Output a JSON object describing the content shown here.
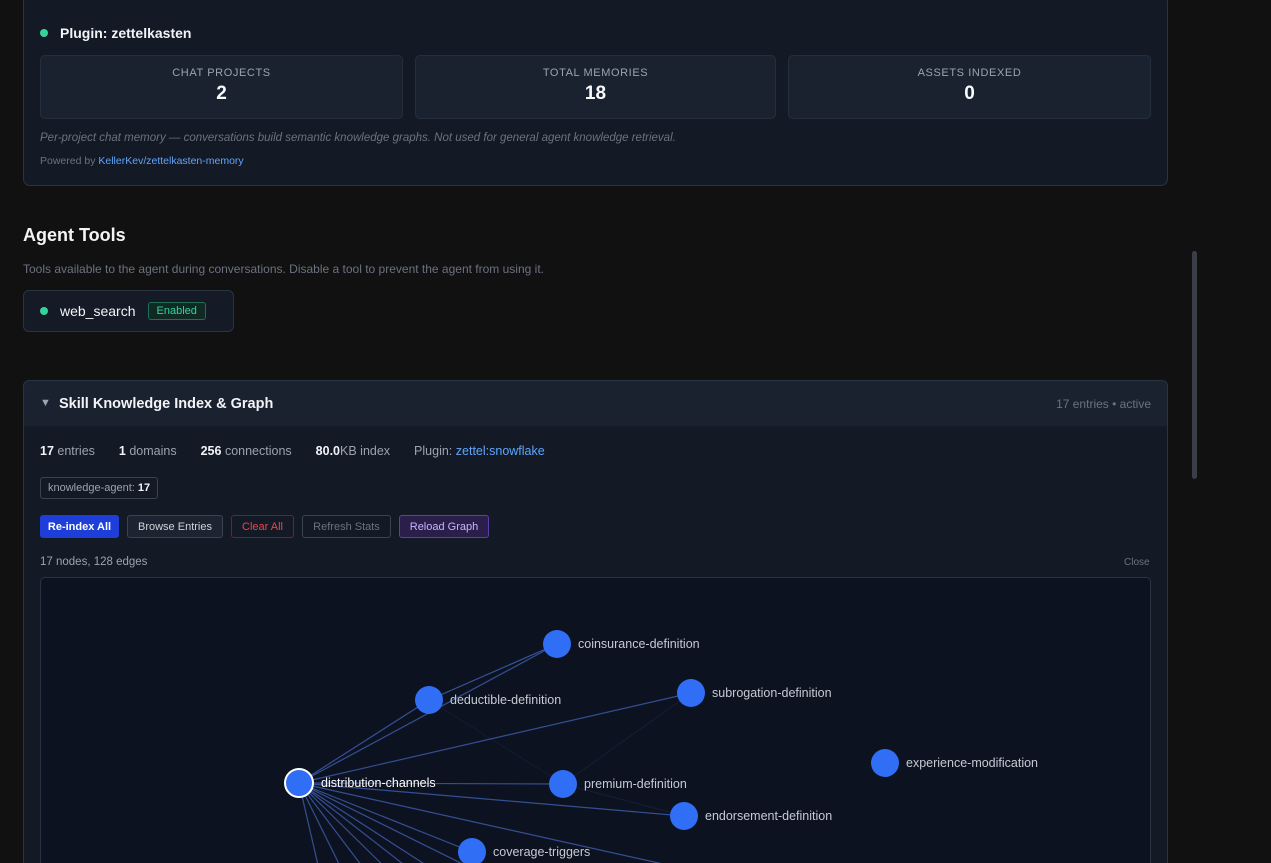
{
  "plugin": {
    "title": "Plugin: zettelkasten",
    "status_color": "#34d399",
    "stats": [
      {
        "label": "CHAT PROJECTS",
        "value": "2"
      },
      {
        "label": "TOTAL MEMORIES",
        "value": "18"
      },
      {
        "label": "ASSETS INDEXED",
        "value": "0"
      }
    ],
    "description": "Per-project chat memory — conversations build semantic knowledge graphs. Not used for general agent knowledge retrieval.",
    "powered_prefix": "Powered by",
    "powered_link": "KellerKev/zettelkasten-memory"
  },
  "agent_tools": {
    "title": "Agent Tools",
    "description": "Tools available to the agent during conversations. Disable a tool to prevent the agent from using it.",
    "tools": [
      {
        "name": "web_search",
        "status": "Enabled"
      }
    ]
  },
  "skill_index": {
    "title": "Skill Knowledge Index & Graph",
    "caret_icon": "caret-down-icon",
    "meta": "17 entries • active",
    "stats": {
      "entries_value": "17",
      "entries_label": "entries",
      "domains_value": "1",
      "domains_label": "domains",
      "connections_value": "256",
      "connections_label": "connections",
      "index_value": "80.0",
      "index_label": "KB index",
      "plugin_label": "Plugin:",
      "plugin_value": "zettel:snowflake"
    },
    "domain_tag": {
      "name": "knowledge-agent:",
      "count": "17"
    },
    "buttons": {
      "reindex": "Re-index All",
      "browse": "Browse Entries",
      "clear": "Clear All",
      "refresh": "Refresh Stats",
      "reload": "Reload Graph"
    },
    "graph_meta": "17 nodes, 128 edges",
    "graph_close": "Close"
  },
  "graph": {
    "node_color": "#2f6ef5",
    "edge_color": "#3b5ba8",
    "nodes": [
      {
        "id": "distribution-channels",
        "label": "distribution-channels",
        "selected": true
      },
      {
        "id": "coinsurance-definition",
        "label": "coinsurance-definition"
      },
      {
        "id": "deductible-definition",
        "label": "deductible-definition"
      },
      {
        "id": "subrogation-definition",
        "label": "subrogation-definition"
      },
      {
        "id": "experience-modification",
        "label": "experience-modification"
      },
      {
        "id": "premium-definition",
        "label": "premium-definition"
      },
      {
        "id": "endorsement-definition",
        "label": "endorsement-definition"
      },
      {
        "id": "coverage-triggers",
        "label": "coverage-triggers"
      }
    ]
  }
}
